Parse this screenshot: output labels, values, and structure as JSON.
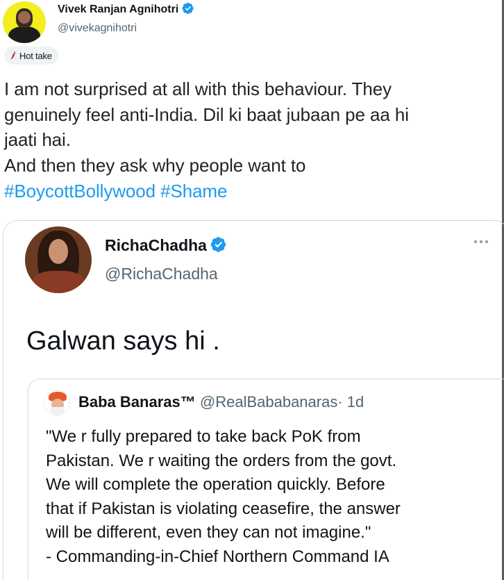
{
  "tweet": {
    "author_name": "Vivek Ranjan Agnihotri",
    "author_handle": "@vivekagnihotri",
    "badge_label": "Hot take",
    "text_lines": [
      "I am not surprised at all with this behaviour. They",
      "genuinely feel anti-India. Dil ki baat jubaan pe aa hi",
      "jaati hai.",
      "And then they ask why people want to"
    ],
    "hashtags": [
      "#BoycottBollywood",
      "#Shame"
    ]
  },
  "quoted": {
    "author_name": "RichaChadha",
    "author_handle": "@RichaChadha",
    "text": "Galwan says hi ."
  },
  "nested": {
    "author_name": "Baba Banaras™",
    "author_handle": "@RealBababanaras",
    "time": "· 1d",
    "text_lines": [
      "\"We r fully prepared to take back PoK from",
      "Pakistan. We r waiting the orders from the govt.",
      "We will complete the operation quickly. Before",
      "that if Pakistan is violating ceasefire, the answer",
      "will be different, even they can not imagine.\"",
      "- Commanding-in-Chief Northern Command IA"
    ]
  },
  "colors": {
    "link": "#1d9bf0",
    "verified": "#1d9bf0",
    "muted": "#536471",
    "border": "#cfd9de",
    "avatar_bg": "#f3ee1f"
  },
  "icons": [
    "verified-badge-icon",
    "chili-pepper-icon",
    "more-options-icon"
  ]
}
